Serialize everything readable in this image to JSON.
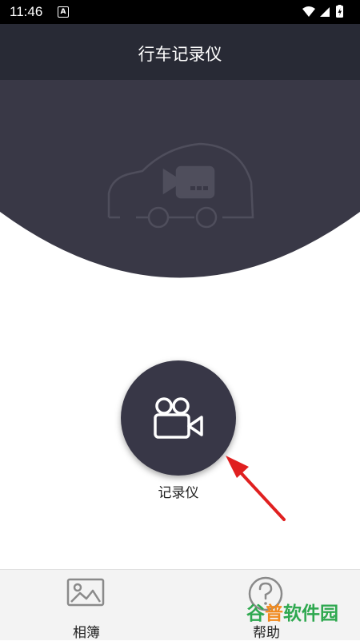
{
  "status_bar": {
    "time": "11:46",
    "notification_glyph": "A",
    "icons": [
      "wifi-icon",
      "signal-icon",
      "battery-charging-icon"
    ]
  },
  "app_bar": {
    "title": "行车记录仪"
  },
  "hero": {
    "illustration": "car-camera-icon"
  },
  "main": {
    "record_button_icon": "video-camera-icon",
    "record_label": "记录仪"
  },
  "bottom_nav": {
    "items": [
      {
        "label": "相簿",
        "icon": "image-icon"
      },
      {
        "label": "帮助",
        "icon": "question-circle-icon"
      }
    ]
  },
  "watermark": {
    "text_a": "谷",
    "text_b": "普",
    "text_c": "软件园"
  },
  "colors": {
    "app_bar": "#282a35",
    "hero": "#393846",
    "button": "#383747",
    "arrow": "#e02020",
    "watermark_green": "#2ea84f",
    "watermark_orange": "#f18a1e"
  }
}
